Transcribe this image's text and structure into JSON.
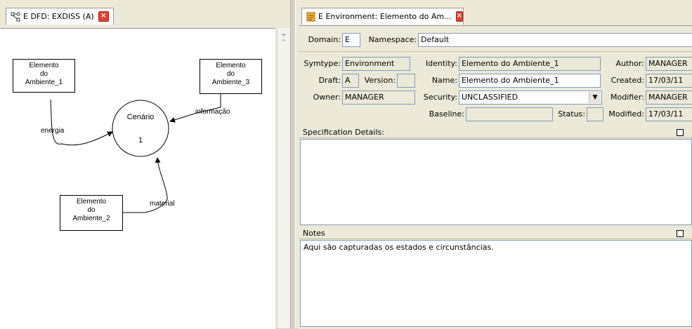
{
  "left_tab": {
    "title": "E DFD: EXDISS (A)",
    "icon": "dfd-diagram-icon"
  },
  "diagram": {
    "process": {
      "name": "Cenário",
      "number": "1"
    },
    "entities": [
      {
        "line1": "Elemento",
        "line2": "do",
        "line3": "Ambiente_1"
      },
      {
        "line1": "Elemento",
        "line2": "do",
        "line3": "Ambiente_3"
      },
      {
        "line1": "Elemento",
        "line2": "do",
        "line3": "Ambiente_2"
      }
    ],
    "flows": {
      "energia": "energia",
      "informacao": "informação",
      "material": "material"
    }
  },
  "right_tab": {
    "title": "E Environment: Elemento do Am...",
    "icon": "document-icon"
  },
  "form": {
    "domain_label": "Domain:",
    "domain_value": "E",
    "namespace_label": "Namespace:",
    "namespace_value": "Default",
    "symtype_label": "Symtype:",
    "symtype_value": "Environment",
    "identity_label": "Identity:",
    "identity_value": "Elemento do Ambiente_1",
    "author_label": "Author:",
    "author_value": "MANAGER",
    "draft_label": "Draft:",
    "draft_value": "A",
    "version_label": "Version:",
    "version_value": "",
    "name_label": "Name:",
    "name_value": "Elemento do Ambiente_1",
    "created_label": "Created:",
    "created_value": "17/03/11",
    "owner_label": "Owner:",
    "owner_value": "MANAGER",
    "security_label": "Security:",
    "security_value": "UNCLASSIFIED",
    "modifier_label": "Modifier:",
    "modifier_value": "MANAGER",
    "baseline_label": "Baseline:",
    "baseline_value": "",
    "status_label": "Status:",
    "status_value": "",
    "modified_label": "Modified:",
    "modified_value": "17/03/11"
  },
  "spec": {
    "header": "Specification Details:",
    "content": ""
  },
  "notes": {
    "header": "Notes",
    "content": "Aqui são capturadas os estados e circunstâncias."
  }
}
